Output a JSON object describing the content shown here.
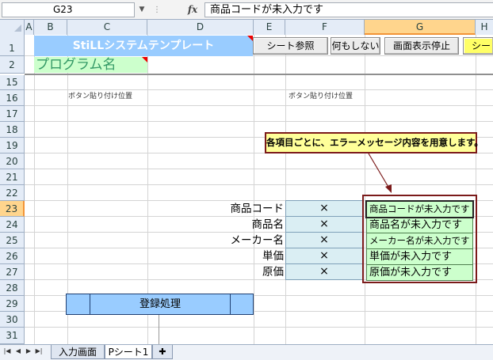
{
  "formula_bar": {
    "name_box": "G23",
    "fx_label": "fx",
    "content": "商品コードが未入力です"
  },
  "columns": [
    "A",
    "B",
    "C",
    "D",
    "E",
    "F",
    "G",
    "H"
  ],
  "selected_column": "G",
  "rows": [
    "1",
    "2",
    "15",
    "16",
    "17",
    "18",
    "19",
    "20",
    "21",
    "22",
    "23",
    "24",
    "25",
    "26",
    "27",
    "28",
    "29",
    "30",
    "31"
  ],
  "selected_row": "23",
  "header_row": {
    "title": "StiLLシステムテンプレート",
    "buttons": [
      "シート参照",
      "何もしない",
      "画面表示停止",
      "シー"
    ]
  },
  "program_name": "プログラム名",
  "button_paste_label_left": "ボタン貼り付け位置",
  "button_paste_label_right": "ボタン貼り付け位置",
  "callout": "各項目ごとに、エラーメッセージ内容を用意します。",
  "fields": [
    {
      "label": "商品コード",
      "value": "×",
      "message": "商品コードが未入力です"
    },
    {
      "label": "商品名",
      "value": "×",
      "message": "商品名が未入力です"
    },
    {
      "label": "メーカー名",
      "value": "×",
      "message": "メーカー名が未入力です"
    },
    {
      "label": "単価",
      "value": "×",
      "message": "単価が未入力です"
    },
    {
      "label": "原価",
      "value": "×",
      "message": "原価が未入力です"
    }
  ],
  "register_button": "登録処理",
  "sheet_tabs": [
    "入力画面",
    "Pシート1"
  ],
  "active_tab": "Pシート1",
  "colors": {
    "title_bg": "#99ccff",
    "program_bg": "#ccffcc",
    "callout_bg": "#ffff99",
    "x_cell_bg": "#daeef3",
    "message_bg": "#ccffcc",
    "selected_header": "#ffd58d"
  }
}
